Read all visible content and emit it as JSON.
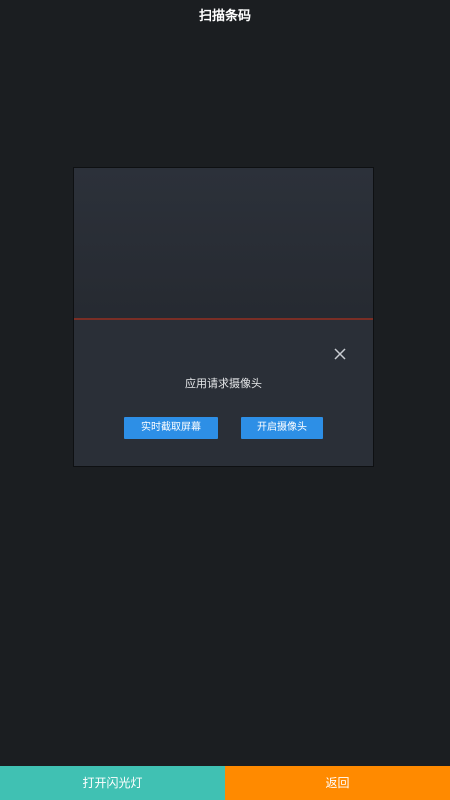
{
  "header": {
    "title": "扫描条码"
  },
  "dialog": {
    "message": "应用请求摄像头",
    "buttons": {
      "screenshot_label": "实时截取屏幕",
      "camera_label": "开启摄像头"
    },
    "close_icon": "close-icon"
  },
  "bottom_bar": {
    "flash_label": "打开闪光灯",
    "back_label": "返回"
  },
  "colors": {
    "background": "#1b1e21",
    "scan_line": "#7a2e25",
    "primary_button": "#2d8fe6",
    "flash_button": "#40c1b3",
    "back_button": "#ff8a00"
  }
}
